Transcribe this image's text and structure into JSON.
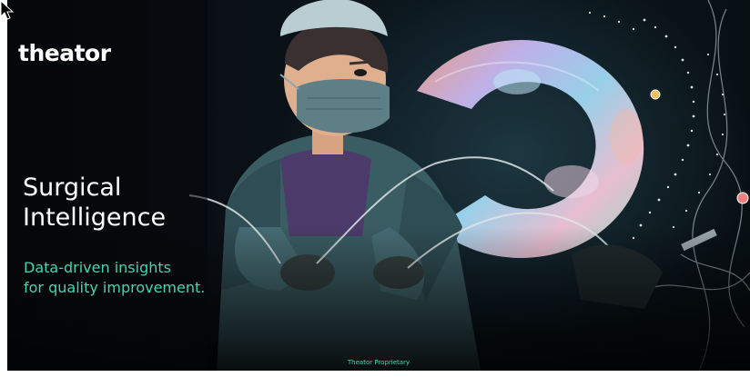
{
  "brand": {
    "logo_text": "theator"
  },
  "hero": {
    "headline_line1": "Surgical",
    "headline_line2": "Intelligence",
    "subline_line1": "Data-driven insights",
    "subline_line2": "for quality improvement."
  },
  "footer": {
    "label": "Theator Proprietary"
  },
  "illustration": {
    "subject": "surgeon-illustration",
    "ring": "iridescent-ring"
  },
  "colors": {
    "background": "#06080c",
    "accent": "#3fd6b3",
    "text": "#ffffff"
  }
}
